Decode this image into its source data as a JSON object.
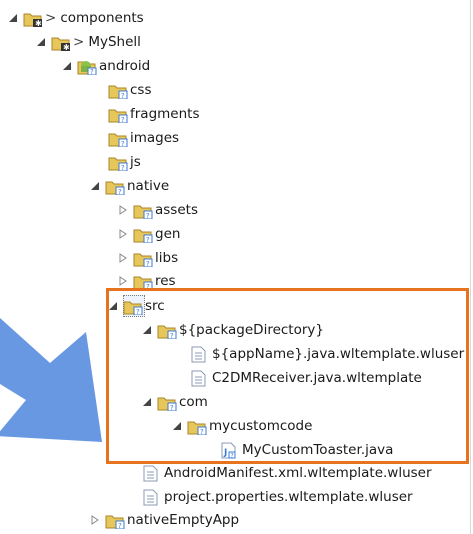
{
  "tree": {
    "rows": [
      {
        "label": "components",
        "prefix": ">"
      },
      {
        "label": "MyShell",
        "prefix": ">"
      },
      {
        "label": "android"
      },
      {
        "label": "css"
      },
      {
        "label": "fragments"
      },
      {
        "label": "images"
      },
      {
        "label": "js"
      },
      {
        "label": "native"
      },
      {
        "label": "assets"
      },
      {
        "label": "gen"
      },
      {
        "label": "libs"
      },
      {
        "label": "res"
      },
      {
        "label": "src"
      },
      {
        "label": "${packageDirectory}"
      },
      {
        "label": "${appName}.java.wltemplate.wluser"
      },
      {
        "label": "C2DMReceiver.java.wltemplate"
      },
      {
        "label": "com"
      },
      {
        "label": "mycustomcode"
      },
      {
        "label": "MyCustomToaster.java"
      },
      {
        "label": "AndroidManifest.xml.wltemplate.wluser"
      },
      {
        "label": "project.properties.wltemplate.wluser"
      },
      {
        "label": "nativeEmptyApp"
      }
    ]
  },
  "colors": {
    "highlight_border": "#E8731E",
    "arrow_fill": "#5B8FE0",
    "folder": "#E8C75A",
    "badge": "#3b7ad6"
  }
}
